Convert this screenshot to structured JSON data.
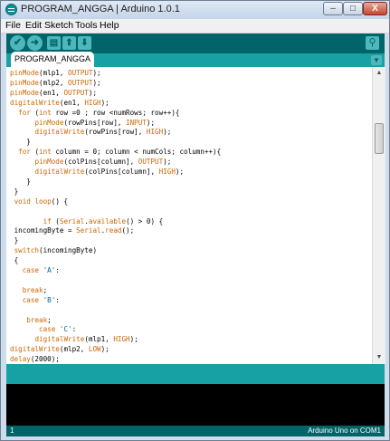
{
  "window": {
    "title": "PROGRAM_ANGGA | Arduino 1.0.1",
    "minimize": "–",
    "maximize": "□",
    "close": "X"
  },
  "menu": [
    "File",
    "Edit",
    "Sketch",
    "Tools",
    "Help"
  ],
  "toolbar": {
    "verify_icon": "checkmark-icon",
    "upload_icon": "arrow-right-icon",
    "new_icon": "new-file-icon",
    "open_icon": "arrow-up-icon",
    "save_icon": "arrow-down-icon",
    "serial_icon": "magnifier-icon",
    "colors": {
      "toolbar": "#006468",
      "button": "#4db7bb",
      "tabbar": "#17a1a5"
    }
  },
  "tab": {
    "label": "PROGRAM_ANGGA",
    "menu_icon": "triangle-down-icon"
  },
  "code": [
    [
      [
        "kw",
        "pinMode"
      ],
      [
        "t",
        "(mlp1, "
      ],
      [
        "kw",
        "OUTPUT"
      ],
      [
        "t",
        ");"
      ]
    ],
    [
      [
        "kw",
        "pinMode"
      ],
      [
        "t",
        "(mlp2, "
      ],
      [
        "kw",
        "OUTPUT"
      ],
      [
        "t",
        ");"
      ]
    ],
    [
      [
        "kw",
        "pinMode"
      ],
      [
        "t",
        "(en1, "
      ],
      [
        "kw",
        "OUTPUT"
      ],
      [
        "t",
        ");"
      ]
    ],
    [
      [
        "kw",
        "digitalWrite"
      ],
      [
        "t",
        "(en1, "
      ],
      [
        "kw",
        "HIGH"
      ],
      [
        "t",
        ");"
      ]
    ],
    [
      [
        "t",
        "  "
      ],
      [
        "kw",
        "for"
      ],
      [
        "t",
        " ("
      ],
      [
        "kw",
        "int"
      ],
      [
        "t",
        " row =0 ; row <numRows; row++){"
      ]
    ],
    [
      [
        "t",
        "      "
      ],
      [
        "kw",
        "pinMode"
      ],
      [
        "t",
        "(rowPins[row], "
      ],
      [
        "kw",
        "INPUT"
      ],
      [
        "t",
        ");"
      ]
    ],
    [
      [
        "t",
        "      "
      ],
      [
        "kw",
        "digitalWrite"
      ],
      [
        "t",
        "(rowPins[row], "
      ],
      [
        "kw",
        "HIGH"
      ],
      [
        "t",
        ");"
      ]
    ],
    [
      [
        "t",
        "    }"
      ]
    ],
    [
      [
        "t",
        "  "
      ],
      [
        "kw",
        "for"
      ],
      [
        "t",
        " ("
      ],
      [
        "kw",
        "int"
      ],
      [
        "t",
        " column = 0; column < numCols; column++){"
      ]
    ],
    [
      [
        "t",
        "      "
      ],
      [
        "kw",
        "pinMode"
      ],
      [
        "t",
        "(colPins[column], "
      ],
      [
        "kw",
        "OUTPUT"
      ],
      [
        "t",
        ");"
      ]
    ],
    [
      [
        "t",
        "      "
      ],
      [
        "kw",
        "digitalWrite"
      ],
      [
        "t",
        "(colPins[column], "
      ],
      [
        "kw",
        "HIGH"
      ],
      [
        "t",
        ");"
      ]
    ],
    [
      [
        "t",
        "    }"
      ]
    ],
    [
      [
        "t",
        " }"
      ]
    ],
    [
      [
        "t",
        " "
      ],
      [
        "kw",
        "void"
      ],
      [
        "t",
        " "
      ],
      [
        "kw",
        "loop"
      ],
      [
        "t",
        "() {"
      ]
    ],
    [
      [
        "t",
        ""
      ]
    ],
    [
      [
        "t",
        "        "
      ],
      [
        "kw",
        "if"
      ],
      [
        "t",
        " ("
      ],
      [
        "kw",
        "Serial"
      ],
      [
        "t",
        "."
      ],
      [
        "kw",
        "available"
      ],
      [
        "t",
        "() > 0) {"
      ]
    ],
    [
      [
        "t",
        " incomingByte = "
      ],
      [
        "kw",
        "Serial"
      ],
      [
        "t",
        "."
      ],
      [
        "kw",
        "read"
      ],
      [
        "t",
        "();"
      ]
    ],
    [
      [
        "t",
        " }"
      ]
    ],
    [
      [
        "t",
        " "
      ],
      [
        "kw",
        "switch"
      ],
      [
        "t",
        "(incomingByte)"
      ]
    ],
    [
      [
        "t",
        " {"
      ]
    ],
    [
      [
        "t",
        "   "
      ],
      [
        "kw",
        "case"
      ],
      [
        "t",
        " "
      ],
      [
        "num",
        "'A'"
      ],
      [
        "t",
        ":"
      ]
    ],
    [
      [
        "t",
        ""
      ]
    ],
    [
      [
        "t",
        "   "
      ],
      [
        "kw",
        "break"
      ],
      [
        "t",
        ";"
      ]
    ],
    [
      [
        "t",
        "   "
      ],
      [
        "kw",
        "case"
      ],
      [
        "t",
        " "
      ],
      [
        "num",
        "'B'"
      ],
      [
        "t",
        ":"
      ]
    ],
    [
      [
        "t",
        ""
      ]
    ],
    [
      [
        "t",
        "    "
      ],
      [
        "kw",
        "break"
      ],
      [
        "t",
        ";"
      ]
    ],
    [
      [
        "t",
        "       "
      ],
      [
        "kw",
        "case"
      ],
      [
        "t",
        " "
      ],
      [
        "num",
        "'C'"
      ],
      [
        "t",
        ":"
      ]
    ],
    [
      [
        "t",
        "      "
      ],
      [
        "kw",
        "digitalWrite"
      ],
      [
        "t",
        "(mlp1, "
      ],
      [
        "kw",
        "HIGH"
      ],
      [
        "t",
        ");"
      ]
    ],
    [
      [
        "kw",
        "digitalWrite"
      ],
      [
        "t",
        "(mlp2, "
      ],
      [
        "kw",
        "LOW"
      ],
      [
        "t",
        ");"
      ]
    ],
    [
      [
        "kw",
        "delay"
      ],
      [
        "t",
        "(2000);"
      ]
    ]
  ],
  "status": {
    "line": "1",
    "board": "Arduino Uno on COM1"
  }
}
